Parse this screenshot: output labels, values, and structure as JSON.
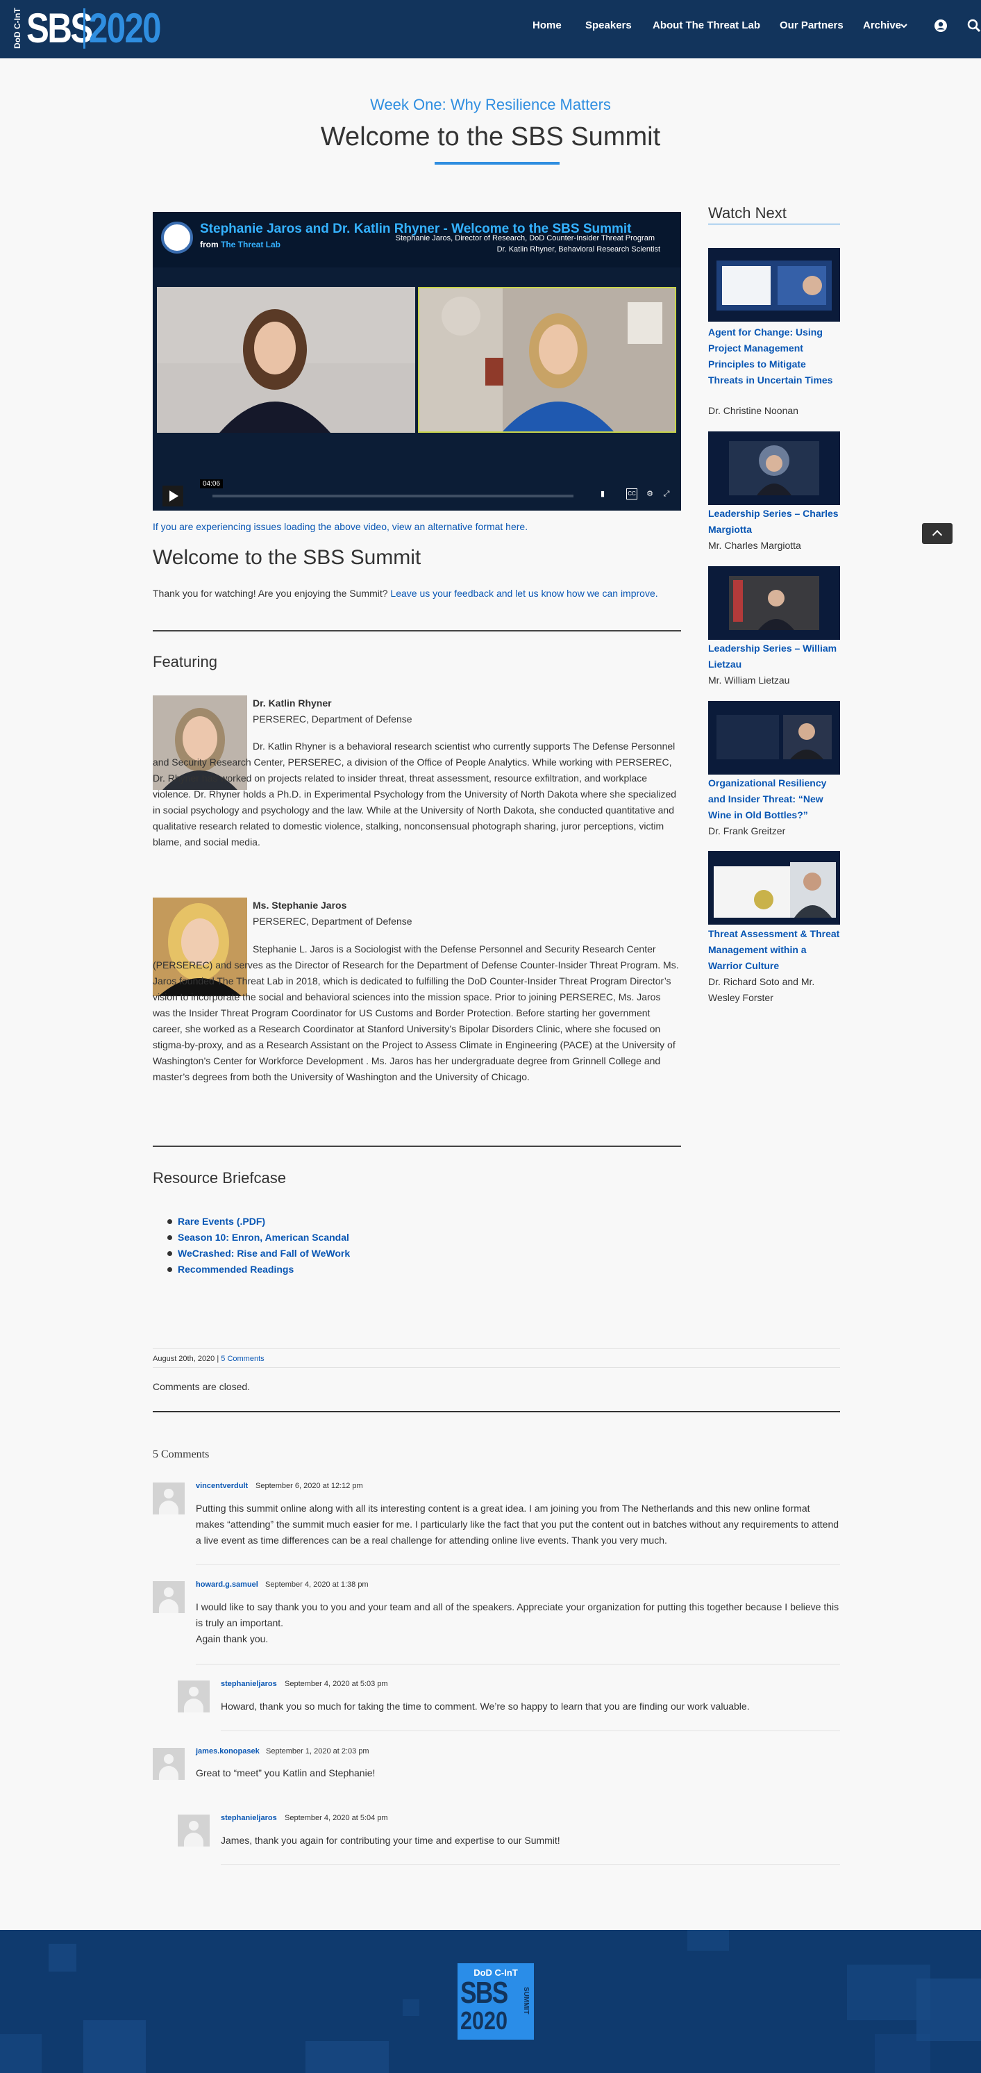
{
  "header": {
    "logo_dod": "DoD C-InT",
    "logo_sbs": "SBS",
    "logo_year": "2020",
    "nav": [
      "Home",
      "Speakers",
      "About The Threat Lab",
      "Our Partners",
      "Archive"
    ],
    "icons": [
      "chevron-down-icon",
      "user-icon",
      "search-icon"
    ]
  },
  "page": {
    "kicker": "Week One: Why Resilience Matters",
    "title": "Welcome to the SBS Summit"
  },
  "video": {
    "title": "Stephanie Jaros and Dr. Katlin Rhyner - Welcome to the SBS Summit",
    "from_prefix": "from ",
    "from_org": "The Threat Lab",
    "subtitle_1": "Stephanie Jaros, Director of Research, DoD Counter-Insider Threat Program",
    "subtitle_2": "Dr. Katlin Rhyner, Behavioral Research Scientist",
    "time": "04:06"
  },
  "alt_link": "If you are experiencing issues loading the above video, view an alternative format here.",
  "intro": {
    "heading": "Welcome to the SBS Summit",
    "text_before": "Thank you for watching! Are you enjoying the Summit? ",
    "link": "Leave us your feedback and let us know how we can improve."
  },
  "featuring": {
    "heading": "Featuring",
    "people": [
      {
        "name": "Dr. Katlin Rhyner",
        "org": "PERSEREC, Department of Defense",
        "bio": "Dr. Katlin Rhyner is a behavioral research scientist who currently supports The Defense Personnel and Security Research Center, PERSEREC, a division of the Office of People Analytics. While working with PERSEREC, Dr. Rhyner has worked on projects related to insider threat, threat assessment, resource exfiltration, and workplace violence. Dr. Rhyner holds a Ph.D. in Experimental Psychology from the University of North Dakota where she specialized in social psychology and psychology and the law. While at the University of North Dakota, she conducted quantitative and qualitative research related to domestic violence, stalking, nonconsensual photograph sharing, juror perceptions, victim blame, and social media."
      },
      {
        "name": "Ms. Stephanie Jaros",
        "org": "PERSEREC, Department of Defense",
        "bio": "Stephanie L. Jaros is a Sociologist with the Defense Personnel and Security Research Center (PERSEREC) and serves as the Director of Research for the Department of Defense Counter-Insider Threat Program. Ms. Jaros founded The Threat Lab in 2018, which is dedicated to fulfilling the DoD Counter-Insider Threat Program Director’s vision to incorporate the social and behavioral sciences into the mission space. Prior to joining PERSEREC, Ms. Jaros was the Insider Threat Program Coordinator for US Customs and Border Protection. Before starting her government career, she worked as a Research Coordinator at Stanford University’s Bipolar Disorders Clinic, where she focused on stigma-by-proxy, and as a Research Assistant on the Project to Assess Climate in Engineering (PACE) at the University of Washington’s Center for Workforce Development . Ms. Jaros has her undergraduate degree from Grinnell College and master’s degrees from both the University of Washington and the University of Chicago."
      }
    ]
  },
  "resources": {
    "heading": "Resource Briefcase",
    "items": [
      "Rare Events (.PDF)",
      "Season 10: Enron, American Scandal",
      "WeCrashed: Rise and Fall of WeWork",
      "Recommended Readings"
    ]
  },
  "post_meta": {
    "date": "August 20th, 2020",
    "sep": " | ",
    "comments_link": "5 Comments",
    "closed": "Comments are closed."
  },
  "comments": {
    "count": "5 Comments",
    "items": [
      {
        "author": "vincentverdult",
        "date": "September 6, 2020 at 12:12 pm",
        "text": "Putting this summit online along with all its interesting content is a great idea. I am joining you from The Netherlands and this new online format makes “attending” the summit much easier for me. I particularly like the fact that you put the content out in batches without any requirements to attend a live event as time differences can be a real challenge for attending online live events. Thank you very much."
      },
      {
        "author": "howard.g.samuel",
        "date": "September 4, 2020 at 1:38 pm",
        "text": "I would like to say thank you to you and your team and all of the speakers. Appreciate your organization for putting this together because I believe this is truly an important.\nAgain thank you."
      },
      {
        "author": "stephanieljaros",
        "date": "September 4, 2020 at 5:03 pm",
        "text": "Howard, thank you so much for taking the time to comment. We’re so happy to learn that you are finding our work valuable."
      },
      {
        "author": "james.konopasek",
        "date": "September 1, 2020 at 2:03 pm",
        "text": "Great to “meet” you Katlin and Stephanie!"
      },
      {
        "author": "stephanieljaros",
        "date": "September 4, 2020 at 5:04 pm",
        "text": "James, thank you again for contributing your time and expertise to our Summit!"
      }
    ]
  },
  "sidebar": {
    "title": "Watch Next",
    "items": [
      {
        "title": "Agent for Change: Using Project Management Principles to Mitigate Threats in Uncertain Times",
        "speaker": "Dr. Christine Noonan"
      },
      {
        "title": "Leadership Series – Charles Margiotta",
        "speaker": "Mr. Charles Margiotta"
      },
      {
        "title": "Leadership Series – William Lietzau",
        "speaker": "Mr. William Lietzau"
      },
      {
        "title": "Organizational Resiliency and Insider Threat: “New Wine in Old Bottles?”",
        "speaker": "Dr. Frank Greitzer"
      },
      {
        "title": "Threat Assessment & Threat Management within a Warrior Culture",
        "speaker": "Dr. Richard Soto and Mr. Wesley Forster"
      }
    ]
  },
  "footer": {
    "logo_dod": "DoD C-InT",
    "logo_sbs": "SBS",
    "logo_year": "2020",
    "logo_vertical": "SUMMIT"
  },
  "colors": {
    "nav_bg": "#12345c",
    "accent": "#2f8ee0",
    "link": "#0a57b4",
    "footer_bg": "#0f3a6e"
  }
}
